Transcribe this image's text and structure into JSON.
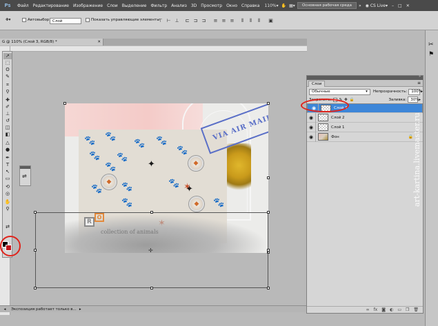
{
  "menubar": {
    "app_icon": "Ps",
    "items": [
      "Файл",
      "Редактирование",
      "Изображение",
      "Слои",
      "Выделение",
      "Фильтр",
      "Анализ",
      "3D",
      "Просмотр",
      "Окно",
      "Справка"
    ],
    "zoom": "110%",
    "workspace": "Основная рабочая среда",
    "cslive": "CS Live"
  },
  "optionsbar": {
    "autoselect_label": "Автовыбор:",
    "autoselect_value": "Слой",
    "show_controls_label": "Показать управляющие элементы"
  },
  "document": {
    "tab_title": "G @ 110% (Слой 3, RGB/8) *"
  },
  "canvas": {
    "stamp_text": "VIA AIR MAIL",
    "logo_letter_1": "R",
    "logo_letter_2": "O",
    "caption": "collection of animals"
  },
  "statusbar": {
    "message": "Экспозиция работает только в..."
  },
  "layers_panel": {
    "tab": "Слои",
    "blend_mode": "Обычные",
    "opacity_label": "Непрозрачность:",
    "opacity_value": "100%",
    "lock_label": "Закрепить:",
    "fill_label": "Заливка:",
    "fill_value": "30%",
    "layers": [
      {
        "name": "Слой 3",
        "selected": true
      },
      {
        "name": "Слой 2",
        "selected": false
      },
      {
        "name": "Слой 1",
        "selected": false
      },
      {
        "name": "Фон",
        "selected": false,
        "locked": true
      }
    ]
  },
  "watermark": "art-kartina.livemaster.ru",
  "colors": {
    "foreground": "#000000",
    "background": "#c0141a",
    "selection": "#3d86d8",
    "annotation": "#e0241c"
  }
}
